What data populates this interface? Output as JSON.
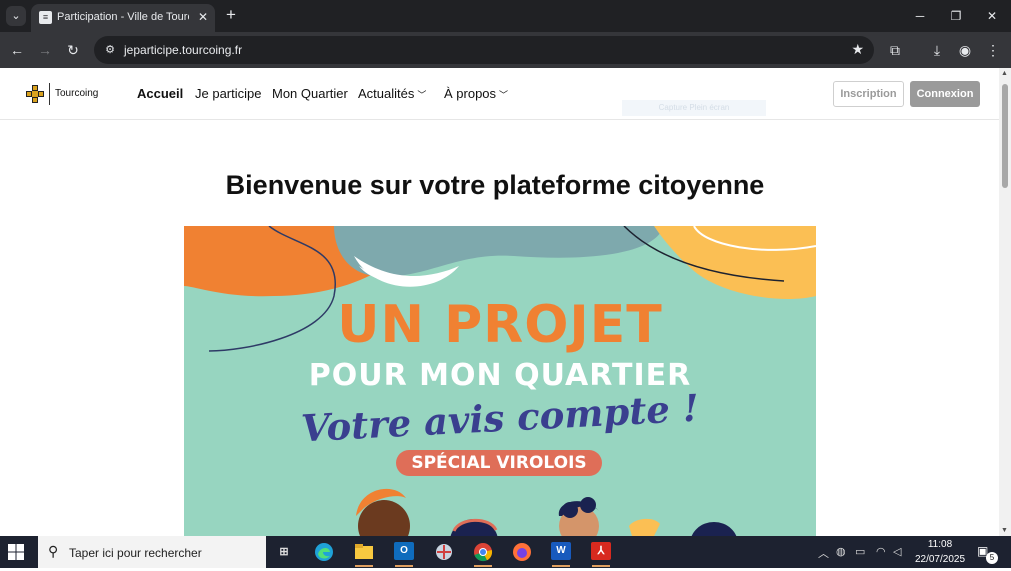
{
  "browser": {
    "tab_title": "Participation - Ville de Tourcoing",
    "url": "jeparticipe.tourcoing.fr",
    "icons": [
      "tab-search-icon",
      "close-icon",
      "plus-icon",
      "minimize-icon",
      "maximize-icon",
      "back-icon",
      "forward-icon",
      "reload-icon",
      "site-info-icon",
      "star-icon",
      "extensions-icon",
      "download-icon",
      "profile-icon",
      "menu-icon"
    ]
  },
  "site": {
    "logo_text": "Tourcoing",
    "nav": [
      {
        "label": "Accueil"
      },
      {
        "label": "Je participe"
      },
      {
        "label": "Mon Quartier"
      },
      {
        "label": "Actualités"
      },
      {
        "label": "À propos"
      }
    ],
    "capture_hint": "Capture Plein écran",
    "inscription": "Inscription",
    "connexion": "Connexion"
  },
  "main": {
    "title": "Bienvenue sur votre plateforme citoyenne",
    "banner": {
      "line1": "UN PROJET",
      "line2": "POUR MON QUARTIER",
      "line3": "Votre avis compte !",
      "badge": "SPÉCIAL VIROLOIS"
    }
  },
  "taskbar": {
    "search_placeholder": "Taper ici pour rechercher",
    "time": "11:08",
    "date": "22/07/2025",
    "notification_count": "5",
    "apps": [
      "task-view-icon",
      "edge-icon",
      "file-explorer-icon",
      "outlook-icon",
      "app-icon",
      "chrome-icon",
      "firefox-icon",
      "word-icon",
      "acrobat-icon"
    ]
  },
  "colors": {
    "banner_bg": "#97d5c0",
    "banner_orange": "#f08132",
    "banner_blue": "#3a3f8f",
    "badge": "#df6e58"
  }
}
